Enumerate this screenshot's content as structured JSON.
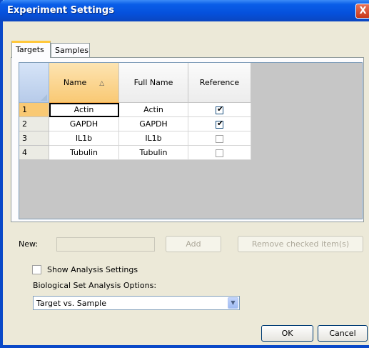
{
  "window": {
    "title": "Experiment Settings",
    "close_glyph": "X"
  },
  "tabs": [
    {
      "label": "Targets",
      "active": true
    },
    {
      "label": "Samples",
      "active": false
    }
  ],
  "grid": {
    "columns": [
      {
        "label": "Name",
        "sorted": true,
        "sort_glyph": "△"
      },
      {
        "label": "Full Name",
        "sorted": false
      },
      {
        "label": "Reference",
        "sorted": false
      }
    ],
    "rows": [
      {
        "num": "1",
        "name": "Actin",
        "full_name": "Actin",
        "reference": true
      },
      {
        "num": "2",
        "name": "GAPDH",
        "full_name": "GAPDH",
        "reference": true
      },
      {
        "num": "3",
        "name": "IL1b",
        "full_name": "IL1b",
        "reference": false
      },
      {
        "num": "4",
        "name": "Tubulin",
        "full_name": "Tubulin",
        "reference": false
      }
    ]
  },
  "new_row": {
    "label": "New:",
    "value": "",
    "add_label": "Add",
    "remove_label": "Remove checked item(s)"
  },
  "analysis": {
    "show_label": "Show Analysis Settings",
    "show_checked": false,
    "options_label": "Biological Set Analysis Options:",
    "selected_option": "Target vs. Sample"
  },
  "footer": {
    "ok_label": "OK",
    "cancel_label": "Cancel"
  },
  "colors": {
    "title_bar": "#0a5ee8",
    "sorted_header": "#f9c974",
    "tab_highlight": "#ffc83c"
  },
  "icons": {
    "check": "✔",
    "dropdown": "▼"
  }
}
